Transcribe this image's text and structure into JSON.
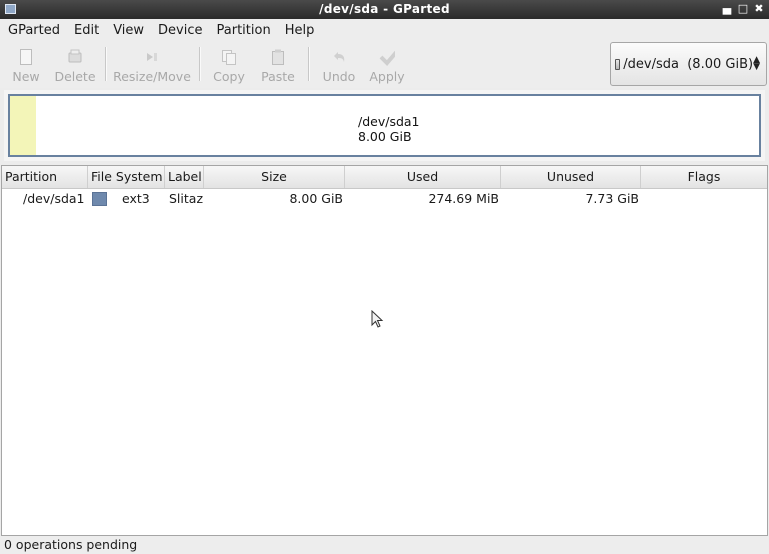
{
  "window": {
    "title": "/dev/sda - GParted"
  },
  "menu": [
    "GParted",
    "Edit",
    "View",
    "Device",
    "Partition",
    "Help"
  ],
  "toolbar": {
    "new": "New",
    "delete": "Delete",
    "resize_move": "Resize/Move",
    "copy": "Copy",
    "paste": "Paste",
    "undo": "Undo",
    "apply": "Apply"
  },
  "device_selector": {
    "value": "/dev/sda  (8.00 GiB)"
  },
  "disk_graph": {
    "partition": "/dev/sda1",
    "size": "8.00 GiB",
    "used_color": "#f3f5b8",
    "border_color": "#68819f"
  },
  "table": {
    "columns": [
      "Partition",
      "File System",
      "Label",
      "Size",
      "Used",
      "Unused",
      "Flags"
    ],
    "rows": [
      {
        "partition": "/dev/sda1",
        "fs_color": "#6f89ad",
        "filesystem": "ext3",
        "label": "Slitaz",
        "size": "8.00 GiB",
        "used": "274.69 MiB",
        "unused": "7.73 GiB",
        "flags": ""
      }
    ]
  },
  "status": "0 operations pending"
}
